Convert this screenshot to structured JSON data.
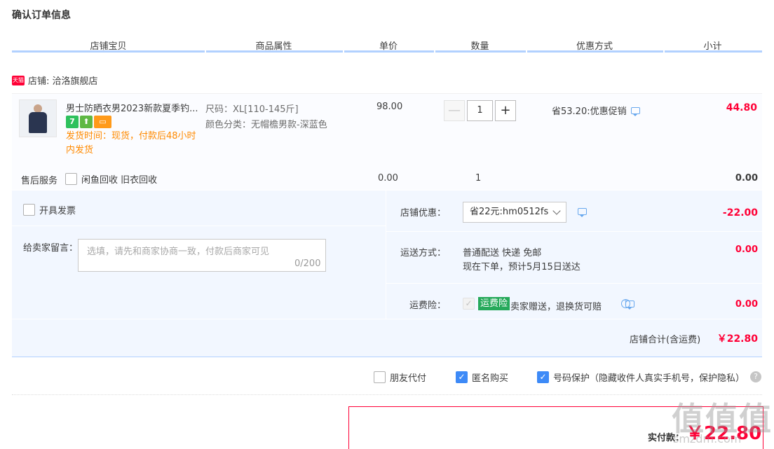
{
  "page_title": "确认订单信息",
  "columns": [
    "店铺宝贝",
    "商品属性",
    "单价",
    "数量",
    "优惠方式",
    "小计"
  ],
  "shop": {
    "badge": "天猫",
    "label": "店铺: 洽洛旗舰店"
  },
  "item": {
    "title": "男士防晒衣男2023新款夏季钓...",
    "badges": [
      "7",
      "⬆",
      "▭"
    ],
    "ship_time": "发货时间：现货，付款后48小时内发货",
    "attr_size": "尺码：XL[110-145斤]",
    "attr_color": "颜色分类：无帽檐男款-深蓝色",
    "price": "98.00",
    "qty_minus": "—",
    "quantity": "1",
    "qty_plus": "+",
    "promo": "省53.20:优惠促销",
    "subtotal": "44.80"
  },
  "after_sales": {
    "label": "售后服务",
    "option": "闲鱼回收 旧衣回收",
    "price": "0.00",
    "quantity": "1",
    "subtotal": "0.00"
  },
  "invoice_label": "开具发票",
  "message": {
    "label": "给卖家留言：",
    "placeholder": "选填，请先和商家协商一致，付款后商家可见",
    "count": "0/200"
  },
  "shop_coupon": {
    "label": "店铺优惠：",
    "value": "省22元:hm0512fs",
    "amount": "-22.00"
  },
  "delivery": {
    "label": "运送方式：",
    "line1": "普通配送 快递 免邮",
    "line2": "现在下单，预计5月15日送达",
    "amount": "0.00"
  },
  "insurance": {
    "label": "运费险：",
    "tag": "运费险",
    "text": "卖家赠送，退换货可赔",
    "help": "?",
    "amount": "0.00"
  },
  "shop_total": {
    "label": "店铺合计(含运费)",
    "amount": "￥22.80"
  },
  "options": {
    "friend_pay": "朋友代付",
    "anonymous": "匿名购买",
    "number_protect": "号码保护（隐藏收件人真实手机号，保护隐私）",
    "help": "?"
  },
  "payment": {
    "label": "实付款：",
    "amount": "￥22.80"
  },
  "watermark": {
    "logo": "值值值",
    "url": "smzdm.com"
  }
}
